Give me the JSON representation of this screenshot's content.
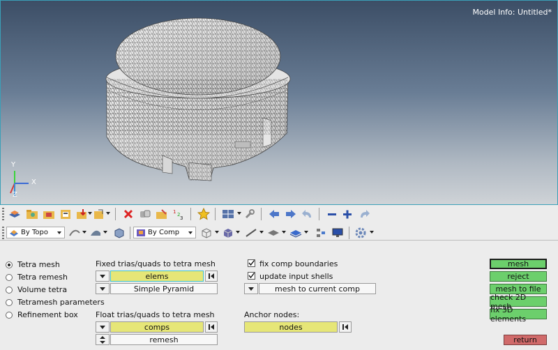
{
  "viewport": {
    "model_info": "Model Info: Untitled*",
    "axes": {
      "y": "Y",
      "x": "X",
      "z": "Z"
    }
  },
  "toolbar": {
    "row1_icons": [
      "open-model-icon",
      "open-folder-icon",
      "import-icon",
      "save-icon",
      "export-icon",
      "session-icon",
      "delete-icon",
      "organize-icon",
      "mask-icon",
      "renumber-icon",
      "favorite-star-icon",
      "view-layout-icon",
      "wrench-icon",
      "arrow-left-icon",
      "arrow-right-icon",
      "undo-icon",
      "zoom-out-icon",
      "zoom-in-icon",
      "redo-icon"
    ],
    "by_topo": "By Topo",
    "by_comp": "By Comp"
  },
  "panel": {
    "radio_options": [
      {
        "label": "Tetra mesh",
        "selected": true
      },
      {
        "label": "Tetra remesh",
        "selected": false
      },
      {
        "label": "Volume tetra",
        "selected": false
      },
      {
        "label": "Tetramesh parameters",
        "selected": false
      },
      {
        "label": "Refinement box",
        "selected": false
      }
    ],
    "fixed_label": "Fixed trias/quads to tetra mesh",
    "fixed_selector": "elems",
    "fixed_option": "Simple Pyramid",
    "float_label": "Float trias/quads to tetra mesh",
    "float_selector": "comps",
    "float_option": "remesh",
    "fix_comp_boundaries": {
      "label": "fix comp boundaries",
      "checked": true
    },
    "update_input_shells": {
      "label": "update input shells",
      "checked": true
    },
    "mesh_target": "mesh to current comp",
    "anchor_label": "Anchor nodes:",
    "anchor_selector": "nodes",
    "buttons": [
      "mesh",
      "reject",
      "mesh to file",
      "check 2D mesh",
      "fix 3D elements"
    ],
    "return_label": "return"
  },
  "colors": {
    "action_green": "#6ccf6c",
    "selector_yellow": "#e6e677",
    "return_red": "#d06a6a"
  }
}
